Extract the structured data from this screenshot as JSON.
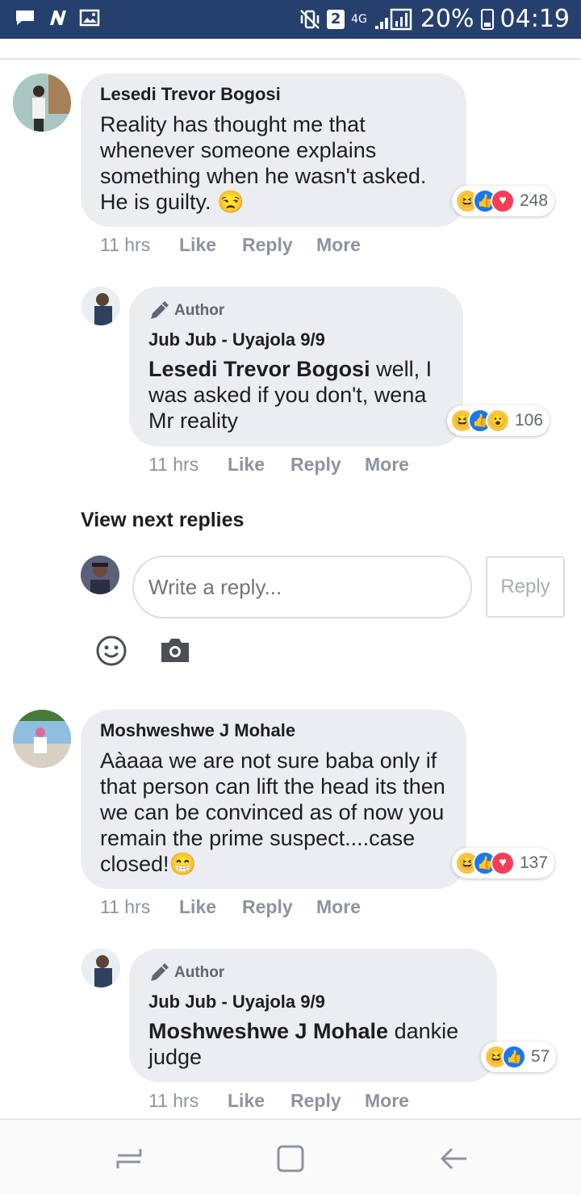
{
  "status_bar": {
    "network_type": "4G",
    "sim_badge": "2",
    "battery": "20%",
    "time": "04:19"
  },
  "comments": [
    {
      "author": "Lesedi Trevor Bogosi",
      "text": "Reality has thought me that whenever someone explains something when he wasn't asked. He is guilty. 😒",
      "reaction_count": "248",
      "time": "11 hrs",
      "like_label": "Like",
      "reply_label": "Reply",
      "more_label": "More",
      "reply": {
        "author_tag": "Author",
        "author": "Jub Jub - Uyajola 9/9",
        "mention": "Lesedi Trevor Bogosi",
        "text": " well, I was asked if you don't, wena Mr reality",
        "reaction_count": "106",
        "time": "11 hrs",
        "like_label": "Like",
        "reply_label": "Reply",
        "more_label": "More"
      }
    },
    {
      "author": "Moshweshwe J Mohale",
      "text": "Aàaaa we are not sure baba only if that person can lift the head its then we can be convinced as of now you remain the prime suspect....case closed!😁",
      "reaction_count": "137",
      "time": "11 hrs",
      "like_label": "Like",
      "reply_label": "Reply",
      "more_label": "More",
      "reply": {
        "author_tag": "Author",
        "author": "Jub Jub - Uyajola 9/9",
        "mention": "Moshweshwe J Mohale",
        "text": " dankie judge",
        "reaction_count": "57",
        "time": "11 hrs",
        "like_label": "Like",
        "reply_label": "Reply",
        "more_label": "More"
      }
    }
  ],
  "view_next_replies": "View next replies",
  "reply_composer": {
    "placeholder": "Write a reply...",
    "button_label": "Reply"
  },
  "colors": {
    "status_bar": "#26406e",
    "bubble": "#ebedf0",
    "like_blue": "#1877f2",
    "love_red": "#f33e58",
    "haha_yellow": "#f7c64a"
  }
}
